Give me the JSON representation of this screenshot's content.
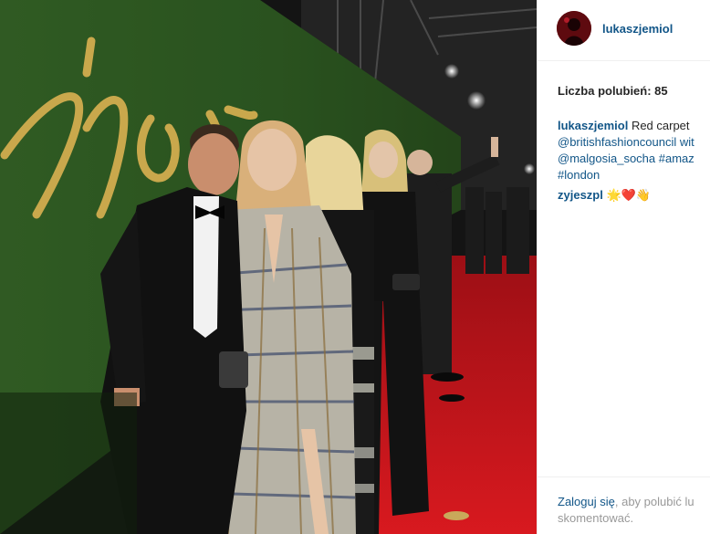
{
  "post": {
    "username": "lukaszjemiol",
    "likes_text": "Liczba polubień: 85",
    "caption": {
      "username": "lukaszjemiol",
      "lines": [
        "Red carpet",
        "@britishfashioncouncil wit",
        "@malgosia_socha #amaz",
        "#london"
      ]
    },
    "comments": [
      {
        "username": "zyjeszpl",
        "text": "🌟❤️👋"
      }
    ],
    "footer": {
      "login_link": "Zaloguj się",
      "login_rest": ", aby polubić lu",
      "login_line2": "skomentować."
    }
  },
  "photo": {
    "wall_lettering": "ion",
    "wall_color": "#2f5a24",
    "carpet_color": "#c4161c"
  }
}
